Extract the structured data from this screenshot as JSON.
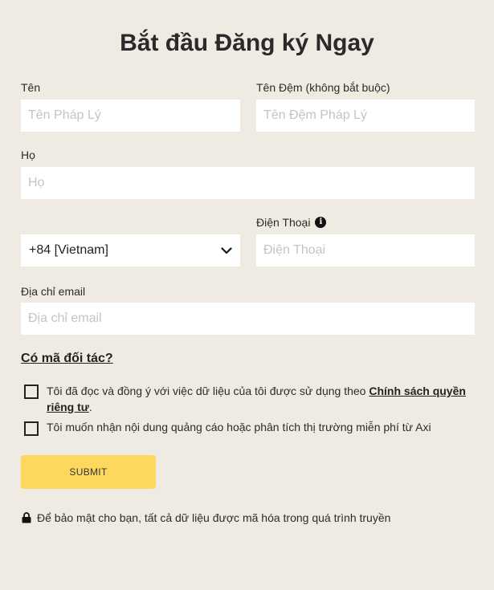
{
  "title": "Bắt đầu Đăng ký Ngay",
  "fields": {
    "first_name": {
      "label": "Tên",
      "placeholder": "Tên Pháp Lý"
    },
    "middle_name": {
      "label": "Tên Đệm (không bắt buộc)",
      "placeholder": "Tên Đệm Pháp Lý"
    },
    "last_name": {
      "label": "Họ",
      "placeholder": "Họ"
    },
    "country_code": {
      "value": "+84 [Vietnam]"
    },
    "phone": {
      "label": "Điện Thoại",
      "placeholder": "Điện Thoại"
    },
    "email": {
      "label": "Địa chỉ email",
      "placeholder": "Địa chỉ email"
    }
  },
  "partner_link": "Có mã đối tác?",
  "consent": {
    "text": "Tôi đã đọc và đồng ý với việc dữ liệu của tôi được sử dụng theo ",
    "link": "Chính sách quyền riêng tư",
    "suffix": "."
  },
  "marketing": {
    "text": "Tôi muốn nhận nội dung quảng cáo hoặc phân tích thị trường miễn phí từ Axi"
  },
  "submit_label": "SUBMIT",
  "security_note": "Để bảo mật cho bạn, tất cả dữ liệu được mã hóa trong quá trình truyền",
  "colors": {
    "background": "#efebe3",
    "submit": "#fcd95c",
    "input": "#ffffff"
  },
  "icons": {
    "phone_info": "info-icon",
    "security": "lock-icon",
    "select": "chevron-down-icon"
  }
}
